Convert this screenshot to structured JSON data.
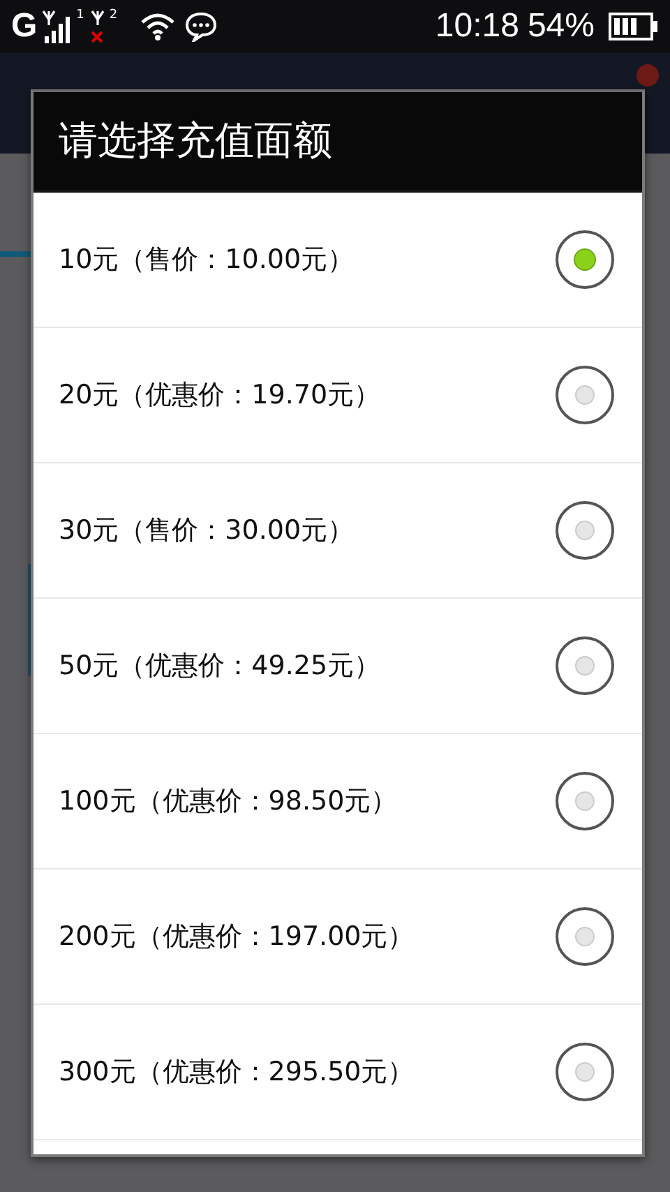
{
  "status_bar": {
    "network": "G",
    "sim1": "1",
    "sim2": "2",
    "time": "10:18",
    "battery": "54%"
  },
  "dialog": {
    "title": "请选择充值面额",
    "options": [
      {
        "label": "10元（售价：10.00元）",
        "selected": true
      },
      {
        "label": "20元（优惠价：19.70元）",
        "selected": false
      },
      {
        "label": "30元（售价：30.00元）",
        "selected": false
      },
      {
        "label": "50元（优惠价：49.25元）",
        "selected": false
      },
      {
        "label": "100元（优惠价：98.50元）",
        "selected": false
      },
      {
        "label": "200元（优惠价：197.00元）",
        "selected": false
      },
      {
        "label": "300元（优惠价：295.50元）",
        "selected": false
      }
    ]
  }
}
